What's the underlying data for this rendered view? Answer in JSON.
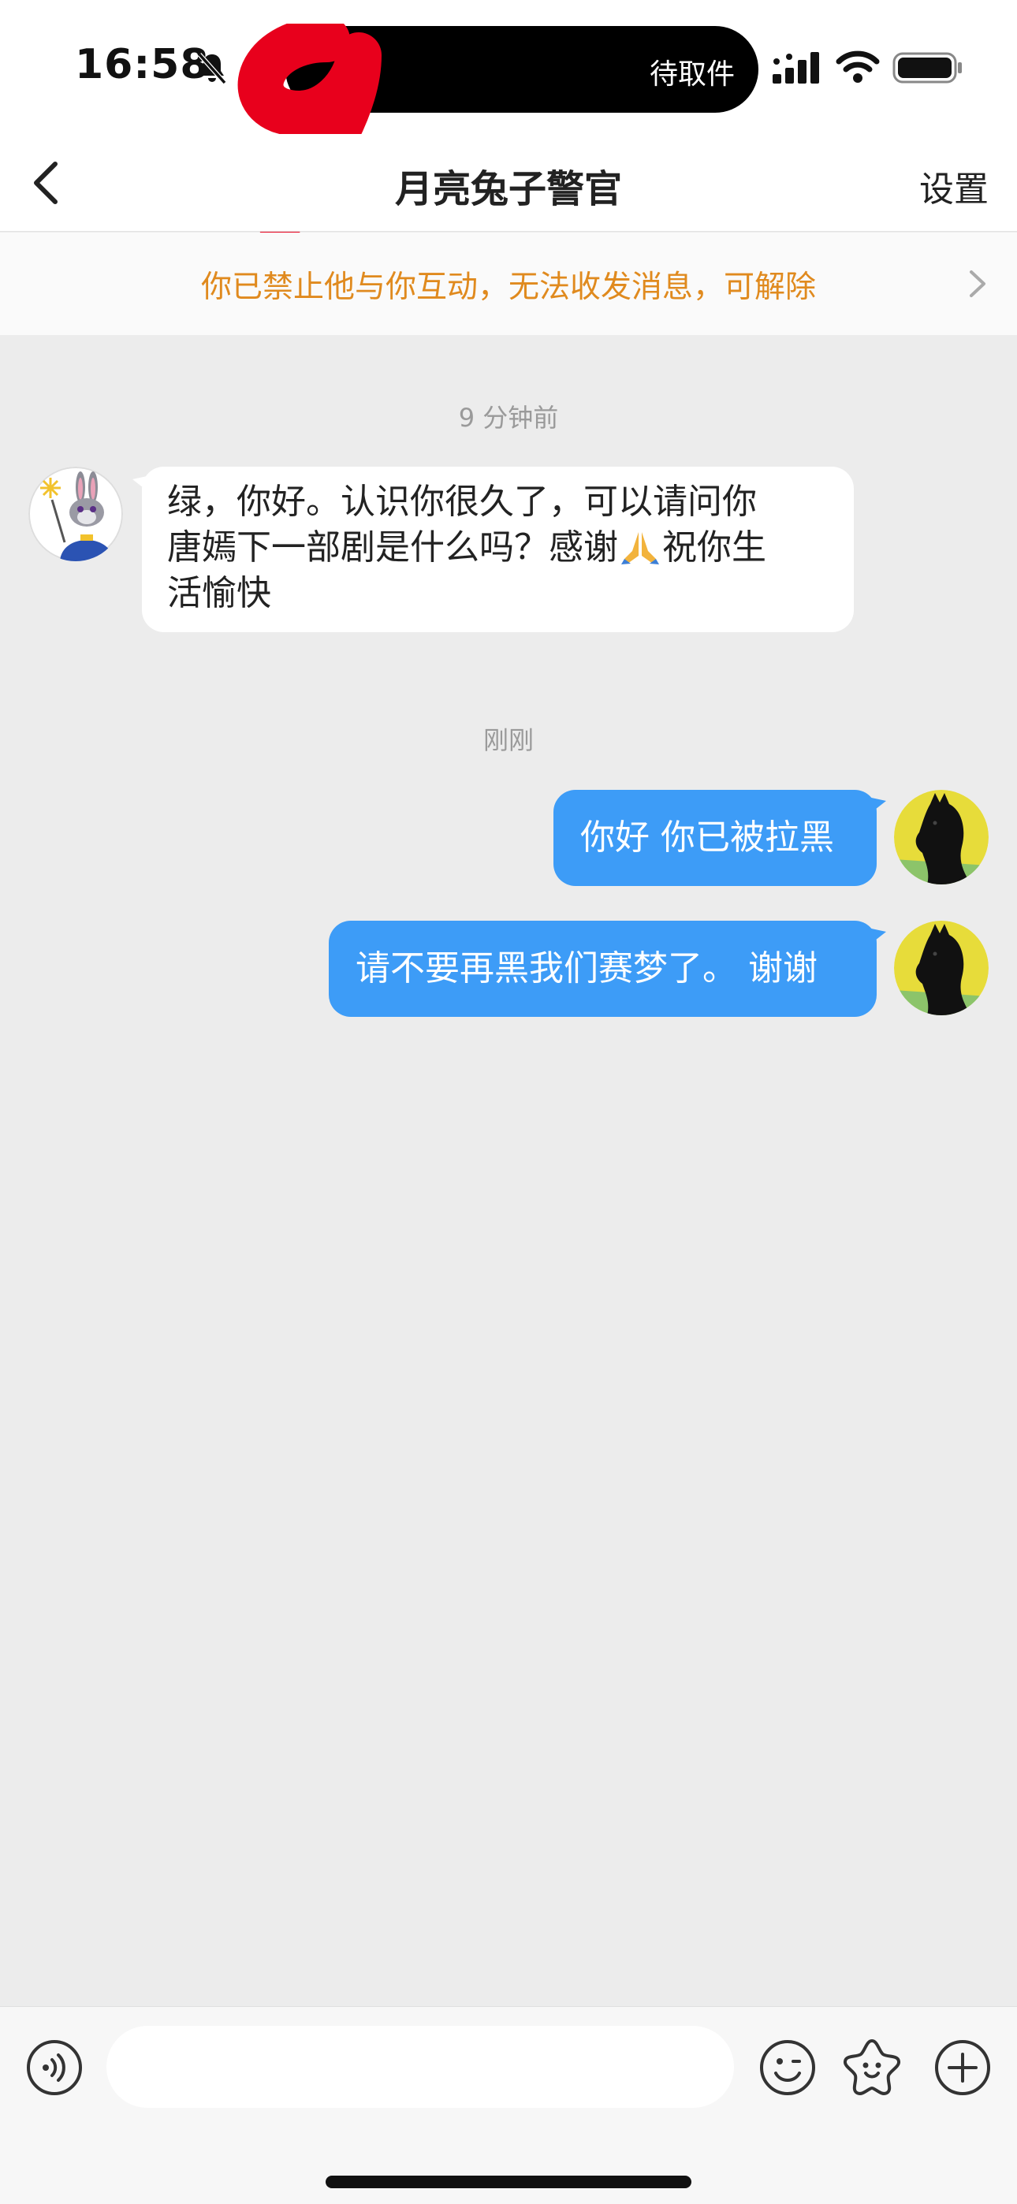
{
  "status_bar": {
    "time": "16:58",
    "island_text": "待取件",
    "icons": [
      "bell-muted-icon",
      "signal-icon",
      "wifi-icon",
      "battery-icon"
    ]
  },
  "nav": {
    "back_icon": "chevron-left-icon",
    "title": "月亮兔子警官",
    "settings_label": "设置"
  },
  "notice": {
    "text": "你已禁止他与你互动，无法收发消息，可解除",
    "icon": "chevron-right-icon"
  },
  "chat": {
    "timestamp_1": "9 分钟前",
    "incoming_message": {
      "line1": "绿，你好。认识你很久了，可以请问你",
      "line2_a": "唐嫣下一部剧是什么吗？感谢",
      "line2_b": "祝你生",
      "line3": "活愉快"
    },
    "timestamp_2": "刚刚",
    "outgoing_message_1": "你好 你已被拉黑",
    "outgoing_message_2": "请不要再黑我们赛梦了。 谢谢"
  },
  "input_bar": {
    "value": "",
    "icons": [
      "voice-icon",
      "emoji-icon",
      "sticker-icon",
      "plus-icon"
    ]
  },
  "colors": {
    "accent_notice": "#e08a1e",
    "bubble_outgoing": "#3d9cf7",
    "background": "#ececec"
  }
}
